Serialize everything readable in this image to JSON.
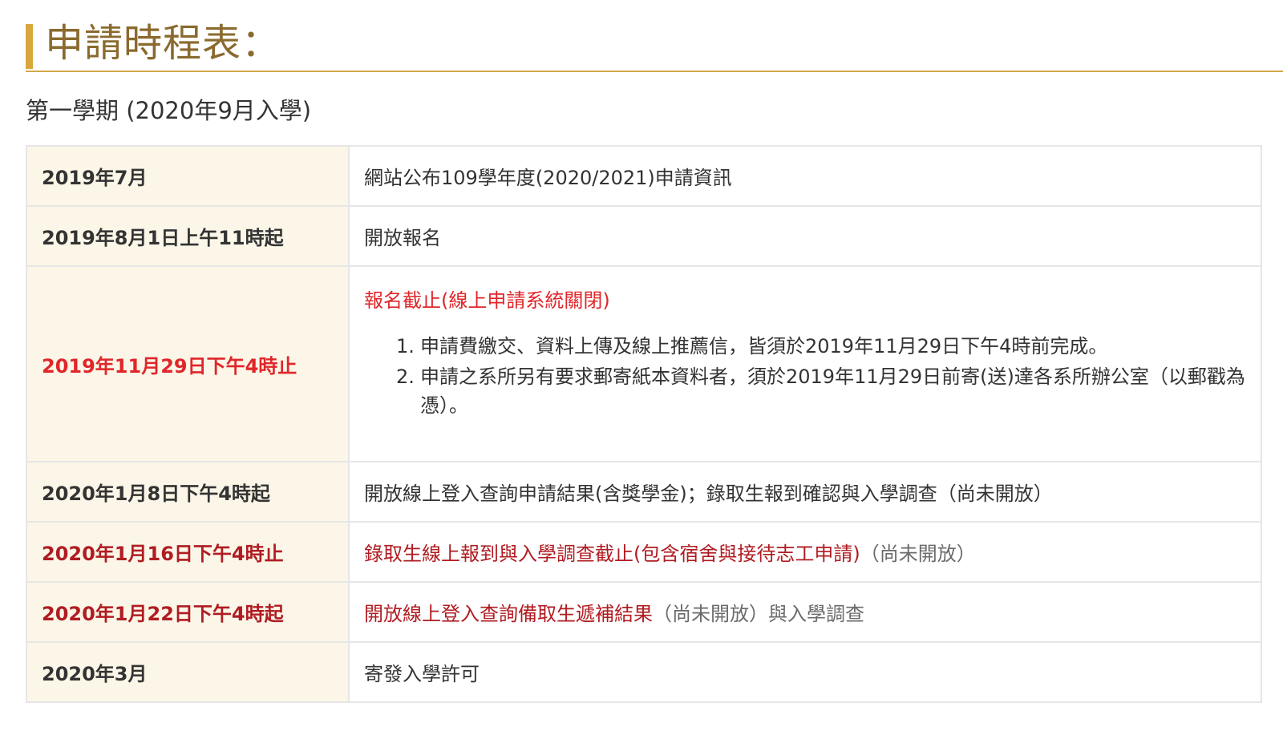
{
  "heading": {
    "title": "申請時程表："
  },
  "subheading": "第一學期 (2020年9月入學)",
  "colors": {
    "accent": "#d7a83c",
    "heading_text": "#8a6a2e",
    "date_bg": "#fbf6e8",
    "red": "#e0262a",
    "dark_red": "#b01c22"
  },
  "schedule": [
    {
      "date": "2019年7月",
      "desc": "網站公布109學年度(2020/2021)申請資訊"
    },
    {
      "date": "2019年8月1日上午11時起",
      "desc": "開放報名"
    },
    {
      "date": "2019年11月29日下午4時止",
      "desc": "報名截止(線上申請系統關閉)",
      "notes": [
        {
          "num": "1.",
          "text": "申請費繳交、資料上傳及線上推薦信，皆須於2019年11月29日下午4時前完成。"
        },
        {
          "num": "2.",
          "text": "申請之系所另有要求郵寄紙本資料者，須於2019年11月29日前寄(送)達各系所辦公室（以郵戳為憑）。"
        }
      ]
    },
    {
      "date": "2020年1月8日下午4時起",
      "desc": "開放線上登入查詢申請結果(含獎學金)；錄取生報到確認與入學調查（尚未開放）"
    },
    {
      "date": "2020年1月16日下午4時止",
      "desc": "錄取生線上報到與入學調查截止(包含宿舍與接待志工申請)",
      "desc_suffix": "（尚未開放）"
    },
    {
      "date": "2020年1月22日下午4時起",
      "desc": "開放線上登入查詢備取生遞補結果",
      "desc_suffix": "（尚未開放）與入學調查"
    },
    {
      "date": "2020年3月",
      "desc": "寄發入學許可"
    }
  ]
}
